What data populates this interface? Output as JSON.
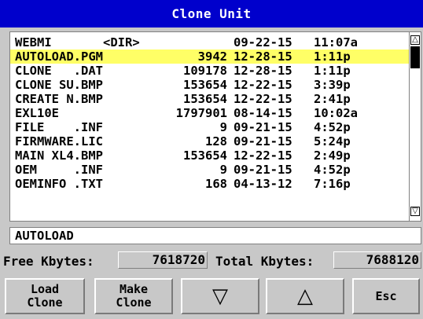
{
  "title": "Clone Unit",
  "files": [
    {
      "name": "WEBMI",
      "dir": "<DIR>",
      "size": "",
      "date": "09-22-15",
      "time": "11:07a",
      "selected": false
    },
    {
      "name": "AUTOLOAD.PGM",
      "dir": "",
      "size": "3942",
      "date": "12-28-15",
      "time": "1:11p",
      "selected": true
    },
    {
      "name": "CLONE   .DAT",
      "dir": "",
      "size": "109178",
      "date": "12-28-15",
      "time": "1:11p",
      "selected": false
    },
    {
      "name": "CLONE SU.BMP",
      "dir": "",
      "size": "153654",
      "date": "12-22-15",
      "time": "3:39p",
      "selected": false
    },
    {
      "name": "CREATE N.BMP",
      "dir": "",
      "size": "153654",
      "date": "12-22-15",
      "time": "2:41p",
      "selected": false
    },
    {
      "name": "EXL10E",
      "dir": "",
      "size": "1797901",
      "date": "08-14-15",
      "time": "10:02a",
      "selected": false
    },
    {
      "name": "FILE    .INF",
      "dir": "",
      "size": "9",
      "date": "09-21-15",
      "time": "4:52p",
      "selected": false
    },
    {
      "name": "FIRMWARE.LIC",
      "dir": "",
      "size": "128",
      "date": "09-21-15",
      "time": "5:24p",
      "selected": false
    },
    {
      "name": "MAIN XL4.BMP",
      "dir": "",
      "size": "153654",
      "date": "12-22-15",
      "time": "2:49p",
      "selected": false
    },
    {
      "name": "OEM     .INF",
      "dir": "",
      "size": "9",
      "date": "09-21-15",
      "time": "4:52p",
      "selected": false
    },
    {
      "name": "OEMINFO .TXT",
      "dir": "",
      "size": "168",
      "date": "04-13-12",
      "time": "7:16p",
      "selected": false
    }
  ],
  "selected_name": "AUTOLOAD",
  "free_label": "Free Kbytes:",
  "free_value": "7618720",
  "total_label": "Total Kbytes:",
  "total_value": "7688120",
  "softkeys": {
    "load": "Load\nClone",
    "make": "Make\nClone",
    "down_icon": "down-triangle-icon",
    "up_icon": "up-triangle-icon",
    "esc": "Esc"
  },
  "colors": {
    "title_bg": "#0000cc",
    "selection": "#ffff66",
    "panel": "#c8c8c8"
  }
}
